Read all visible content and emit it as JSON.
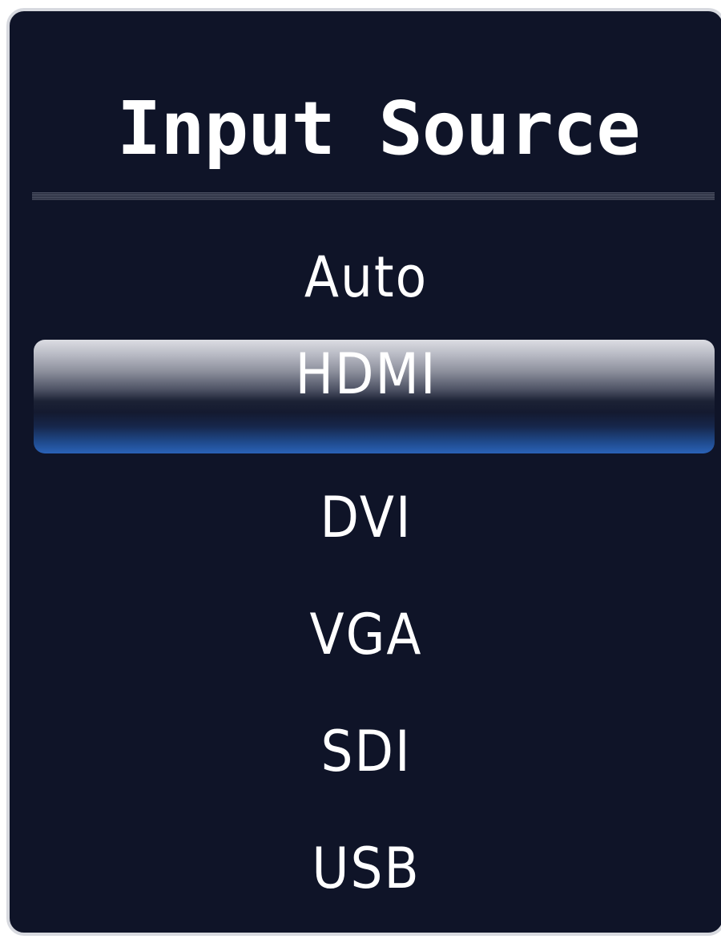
{
  "panel": {
    "title": "Input Source",
    "selected_index": 1,
    "items": [
      {
        "label": "Auto"
      },
      {
        "label": "HDMI"
      },
      {
        "label": "DVI"
      },
      {
        "label": "VGA"
      },
      {
        "label": "SDI"
      },
      {
        "label": "USB"
      }
    ]
  },
  "colors": {
    "panel_background": "#0f1428",
    "panel_border": "#d7d9df",
    "text": "#ffffff",
    "highlight_top": "#dcdde3",
    "highlight_bottom": "#2a62b8"
  }
}
